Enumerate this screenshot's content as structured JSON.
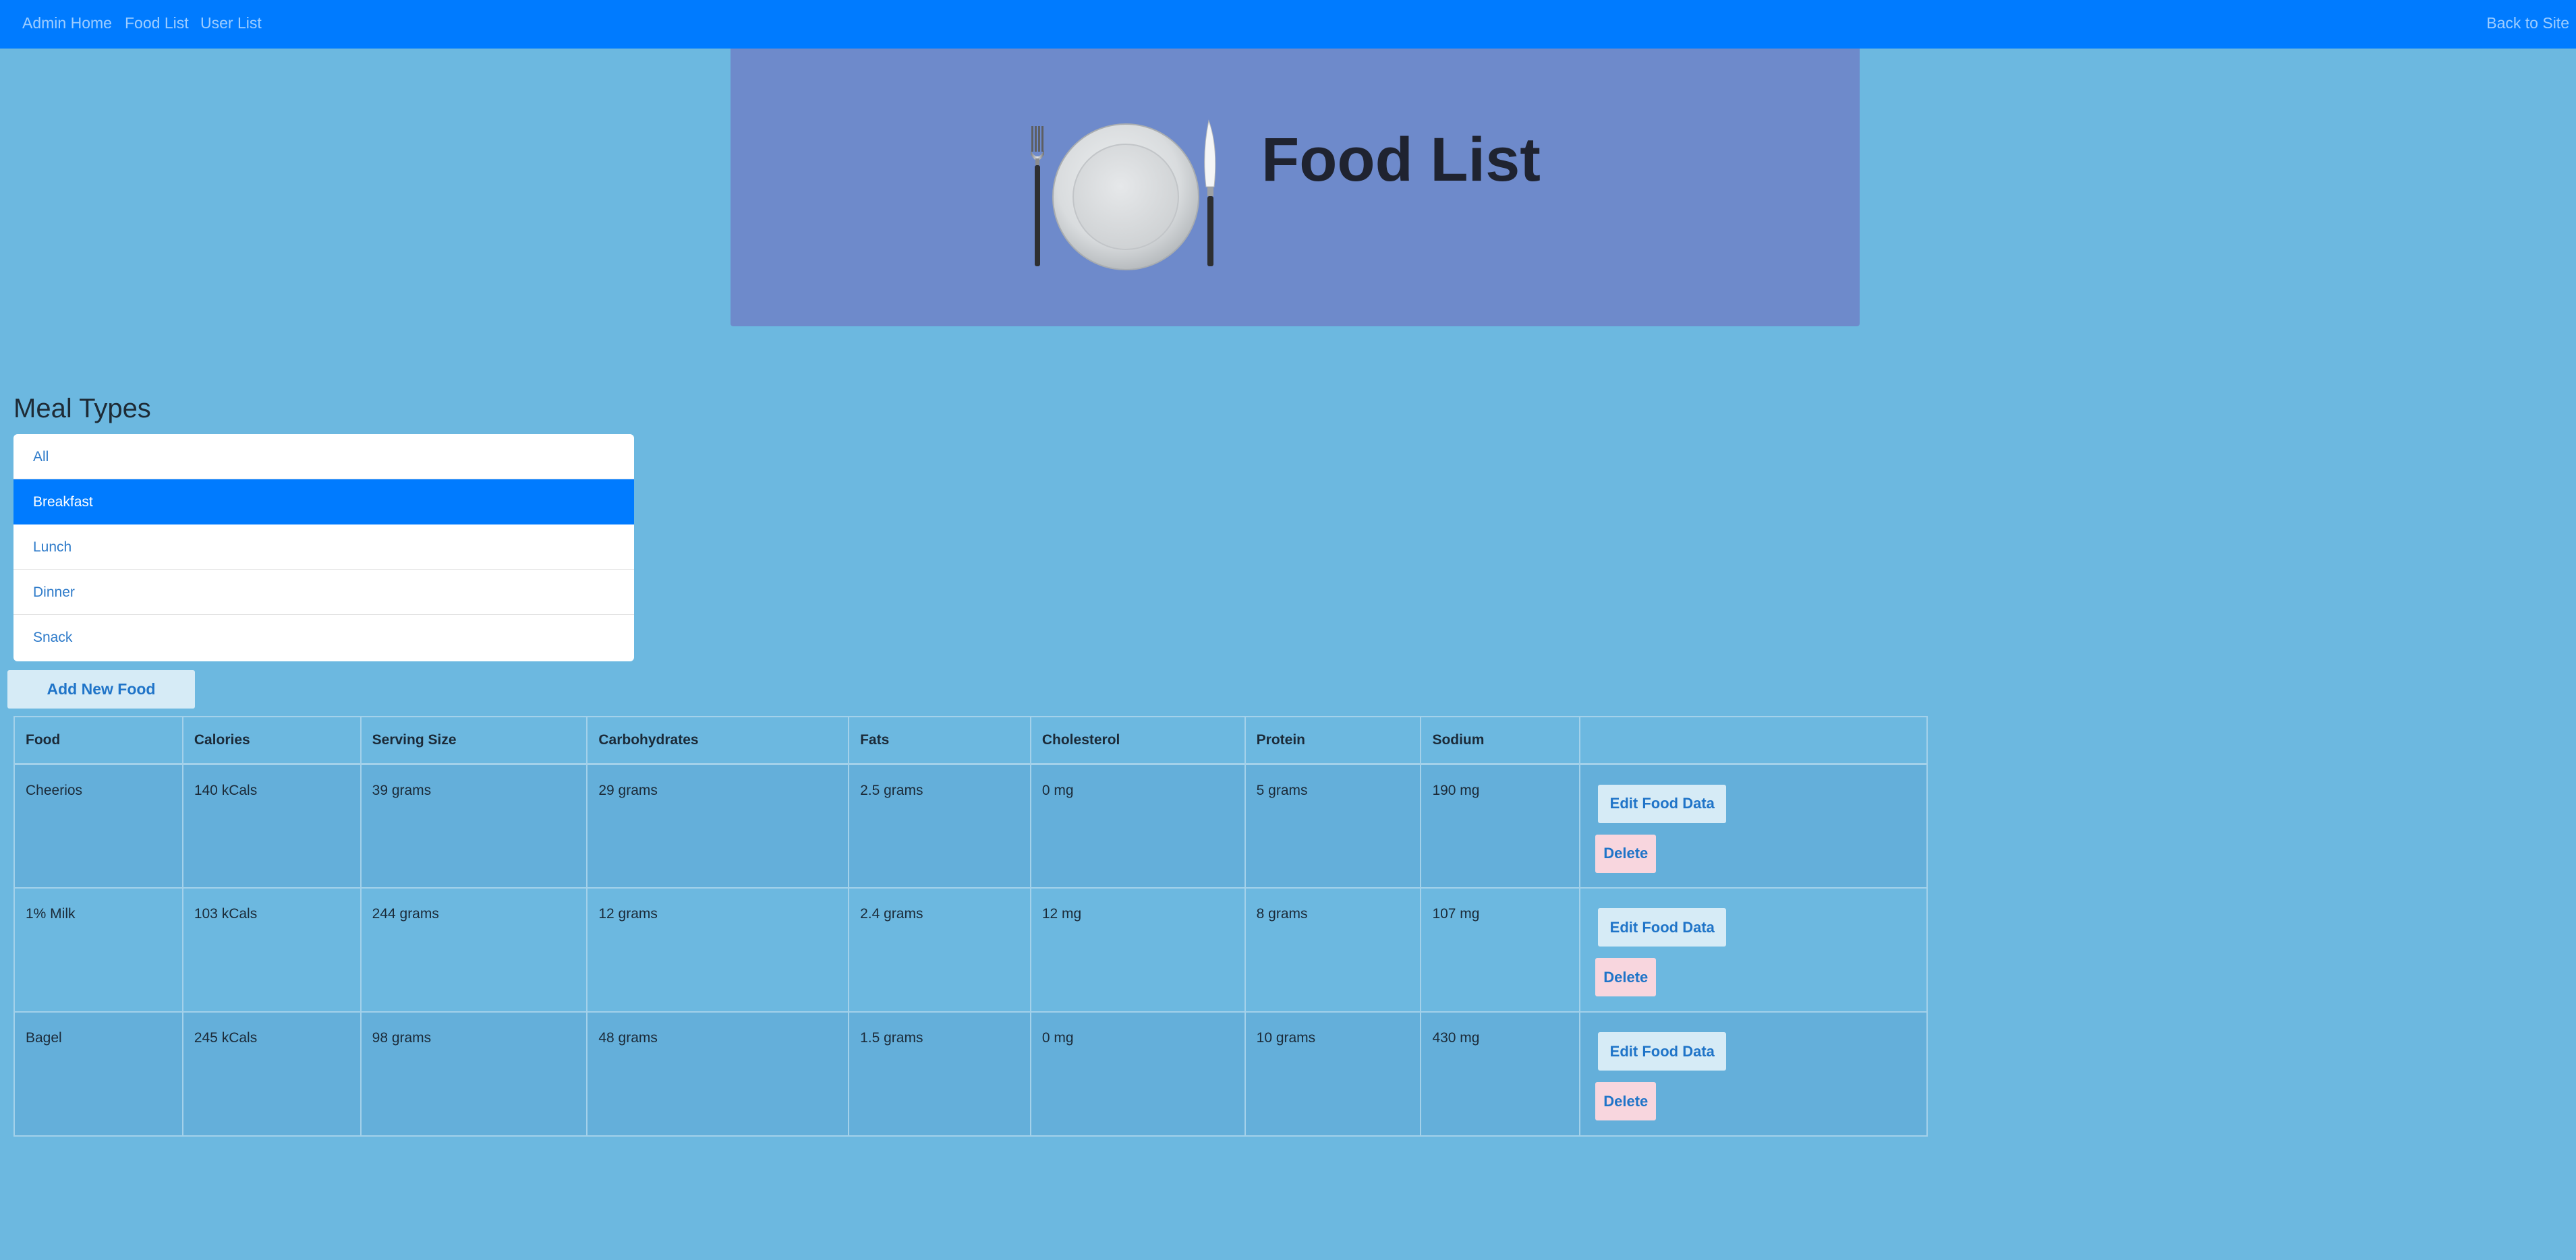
{
  "nav": {
    "admin_home": "Admin Home",
    "food_list": "Food List",
    "user_list": "User List",
    "back_to_site": "Back to Site"
  },
  "banner": {
    "title": "Food List",
    "icon": "place-setting-icon"
  },
  "meal_types": {
    "heading": "Meal Types",
    "items": [
      "All",
      "Breakfast",
      "Lunch",
      "Dinner",
      "Snack"
    ],
    "selected": "Breakfast"
  },
  "add_button": "Add New Food",
  "table": {
    "headers": [
      "Food",
      "Calories",
      "Serving Size",
      "Carbohydrates",
      "Fats",
      "Cholesterol",
      "Protein",
      "Sodium",
      ""
    ],
    "rows": [
      {
        "food": "Cheerios",
        "calories": "140 kCals",
        "serving": "39 grams",
        "carbs": "29 grams",
        "fats": "2.5 grams",
        "cholesterol": "0 mg",
        "protein": "5 grams",
        "sodium": "190 mg"
      },
      {
        "food": "1% Milk",
        "calories": "103 kCals",
        "serving": "244 grams",
        "carbs": "12 grams",
        "fats": "2.4 grams",
        "cholesterol": "12 mg",
        "protein": "8 grams",
        "sodium": "107 mg"
      },
      {
        "food": "Bagel",
        "calories": "245 kCals",
        "serving": "98 grams",
        "carbs": "48 grams",
        "fats": "1.5 grams",
        "cholesterol": "0 mg",
        "protein": "10 grams",
        "sodium": "430 mg"
      }
    ],
    "edit_label": "Edit Food Data",
    "delete_label": "Delete"
  },
  "colors": {
    "background": "#6cb8e0",
    "navbar": "#007bff",
    "banner": "#6e8acb",
    "active_item": "#007bff",
    "edit_button": "#d6ebf6",
    "delete_button": "#f8d6de"
  }
}
